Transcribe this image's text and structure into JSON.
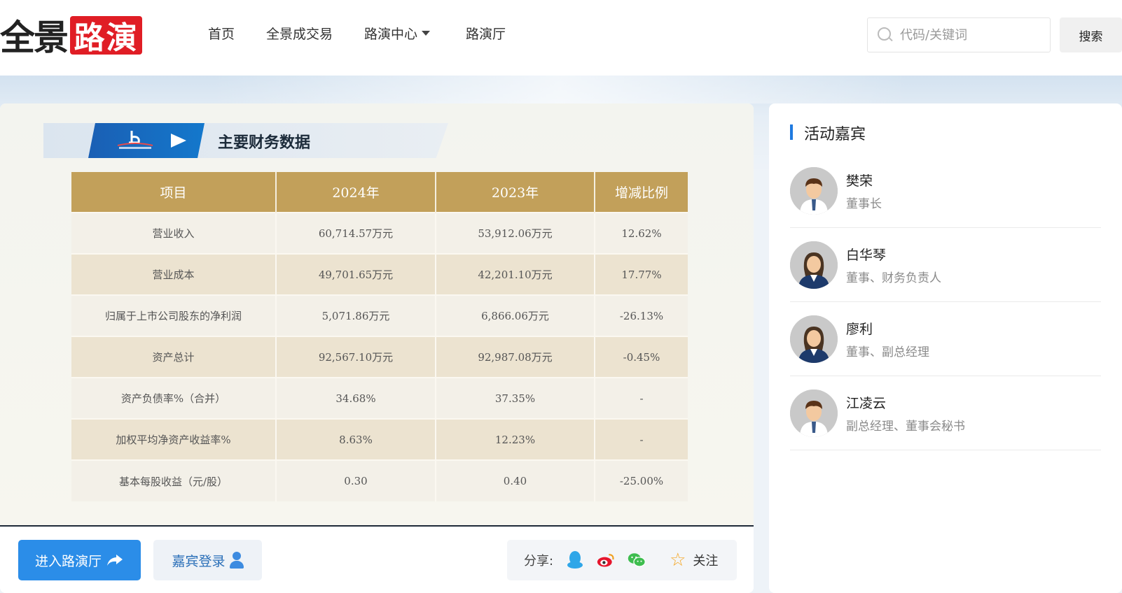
{
  "header": {
    "logo_part1": "全景",
    "logo_part2": "路演",
    "nav": [
      "首页",
      "全景成交易",
      "路演中心",
      "路演厅"
    ],
    "search_placeholder": "代码/关键词",
    "search_button": "搜索"
  },
  "slide": {
    "title": "主要财务数据",
    "table": {
      "headers": [
        "项目",
        "2024年",
        "2023年",
        "增减比例"
      ],
      "rows": [
        [
          "营业收入",
          "60,714.57万元",
          "53,912.06万元",
          "12.62%"
        ],
        [
          "营业成本",
          "49,701.65万元",
          "42,201.10万元",
          "17.77%"
        ],
        [
          "归属于上市公司股东的净利润",
          "5,071.86万元",
          "6,866.06万元",
          "-26.13%"
        ],
        [
          "资产总计",
          "92,567.10万元",
          "92,987.08万元",
          "-0.45%"
        ],
        [
          "资产负债率%（合并）",
          "34.68%",
          "37.35%",
          "-"
        ],
        [
          "加权平均净资产收益率%",
          "8.63%",
          "12.23%",
          "-"
        ],
        [
          "基本每股收益（元/股）",
          "0.30",
          "0.40",
          "-25.00%"
        ]
      ]
    }
  },
  "actions": {
    "enter_label": "进入路演厅",
    "guest_login_label": "嘉宾登录",
    "share_label": "分享:",
    "follow_label": "关注"
  },
  "guests": {
    "title": "活动嘉宾",
    "list": [
      {
        "name": "樊荣",
        "role": "董事长",
        "gender": "male"
      },
      {
        "name": "白华琴",
        "role": "董事、财务负责人",
        "gender": "female"
      },
      {
        "name": "廖利",
        "role": "董事、副总经理",
        "gender": "female"
      },
      {
        "name": "江凌云",
        "role": "副总经理、董事会秘书",
        "gender": "male"
      }
    ]
  },
  "colors": {
    "brand_red": "#e01d25",
    "accent_blue": "#2b8de8",
    "table_header": "#c2a05a"
  }
}
